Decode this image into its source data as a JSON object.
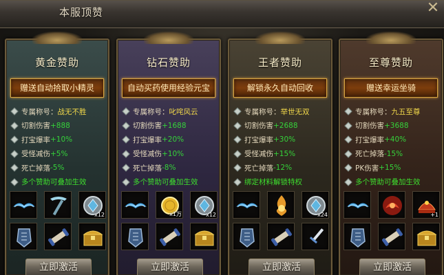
{
  "window": {
    "title": "本服顶赞",
    "close_label": "✕"
  },
  "colors": {
    "gold_border": "#d9a640",
    "green_value": "#35d23a",
    "yellow_title": "#f0d74a"
  },
  "cards": [
    {
      "title": "黄金赞助",
      "banner": "赠送自动拾取小精灵",
      "stats": [
        {
          "label": "专属称号：",
          "value": "战无不胜"
        },
        {
          "label": "切割伤害",
          "value": "+888"
        },
        {
          "label": "打宝爆率",
          "value": "+10%"
        },
        {
          "label": "受怪减伤",
          "value": "+5%"
        },
        {
          "label": "死亡掉落",
          "value": "-5%"
        }
      ],
      "note": "多个赞助可叠加生效",
      "items": [
        {
          "icon": "wing-icon",
          "qty": ""
        },
        {
          "icon": "pickaxe-icon",
          "qty": ""
        },
        {
          "icon": "gem-stone-icon",
          "qty": "x12"
        },
        {
          "icon": "shield-icon",
          "qty": ""
        },
        {
          "icon": "scroll-icon",
          "qty": ""
        },
        {
          "icon": "treasure-chest-icon",
          "qty": ""
        }
      ],
      "button": "立即激活"
    },
    {
      "title": "钻石赞助",
      "banner": "自动买药使用经验元宝",
      "stats": [
        {
          "label": "专属称号：",
          "value": "叱咤风云"
        },
        {
          "label": "切割伤害",
          "value": "+1688"
        },
        {
          "label": "打宝爆率",
          "value": "+20%"
        },
        {
          "label": "受怪减伤",
          "value": "+10%"
        },
        {
          "label": "死亡掉落",
          "value": "-8%"
        }
      ],
      "note": "多个赞助可叠加生效",
      "items": [
        {
          "icon": "wing-icon",
          "qty": ""
        },
        {
          "icon": "gold-coin-icon",
          "qty": "x1万"
        },
        {
          "icon": "gem-stone-icon",
          "qty": "x12"
        },
        {
          "icon": "shield-icon",
          "qty": ""
        },
        {
          "icon": "scroll-icon",
          "qty": ""
        },
        {
          "icon": "treasure-chest-icon",
          "qty": ""
        }
      ],
      "button": "立即激活"
    },
    {
      "title": "王者赞助",
      "banner": "解锁永久自动回收",
      "stats": [
        {
          "label": "专属称号：",
          "value": "举世无双"
        },
        {
          "label": "切割伤害",
          "value": "+2688"
        },
        {
          "label": "打宝爆率",
          "value": "+30%"
        },
        {
          "label": "受怪减伤",
          "value": "+15%"
        },
        {
          "label": "死亡掉落",
          "value": "-12%"
        }
      ],
      "note": "绑定材料解锁特权",
      "items": [
        {
          "icon": "wing-icon",
          "qty": ""
        },
        {
          "icon": "flame-orb-icon",
          "qty": ""
        },
        {
          "icon": "gem-stone-icon",
          "qty": "x24"
        },
        {
          "icon": "shield-icon",
          "qty": ""
        },
        {
          "icon": "scroll-icon",
          "qty": ""
        },
        {
          "icon": "sword-icon",
          "qty": ""
        }
      ],
      "button": "立即激活"
    },
    {
      "title": "至尊赞助",
      "banner": "赠送幸运坐骑",
      "stats": [
        {
          "label": "专属称号：",
          "value": "九五至尊"
        },
        {
          "label": "切割伤害",
          "value": "+3688"
        },
        {
          "label": "打宝爆率",
          "value": "+40%"
        },
        {
          "label": "死亡掉落",
          "value": "-15%"
        },
        {
          "label": "PK伤害",
          "value": "+15%"
        }
      ],
      "note": "多个赞助可叠加生效",
      "items": [
        {
          "icon": "wing-icon",
          "qty": ""
        },
        {
          "icon": "mount-icon",
          "qty": ""
        },
        {
          "icon": "crown-helmet-icon",
          "qty": "+1"
        },
        {
          "icon": "shield-icon",
          "qty": ""
        },
        {
          "icon": "scroll-icon",
          "qty": ""
        },
        {
          "icon": "treasure-chest-icon",
          "qty": ""
        }
      ],
      "button": "立即激活"
    }
  ]
}
